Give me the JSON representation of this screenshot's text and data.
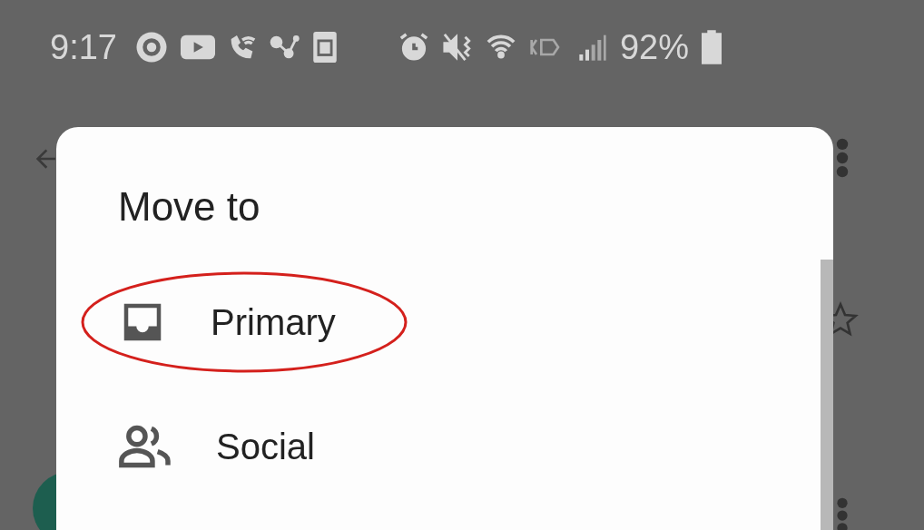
{
  "status_bar": {
    "time": "9:17",
    "battery": "92%"
  },
  "dialog": {
    "title": "Move to",
    "items": [
      {
        "label": "Primary",
        "kind": "inbox",
        "circled": true
      },
      {
        "label": "Social",
        "kind": "people",
        "circled": false
      }
    ]
  },
  "annotation": {
    "kind": "ellipse",
    "color": "#d4201c"
  }
}
